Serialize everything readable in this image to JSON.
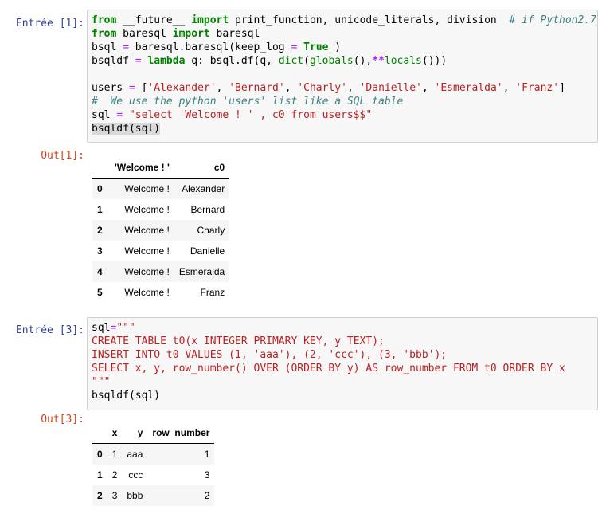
{
  "cells": [
    {
      "in_prompt": "Entrée [1]:",
      "out_prompt": "Out[1]:",
      "table": {
        "columns": [
          "'Welcome ! '",
          "c0"
        ],
        "rows": [
          {
            "index": "0",
            "values": [
              "Welcome !",
              "Alexander"
            ]
          },
          {
            "index": "1",
            "values": [
              "Welcome !",
              "Bernard"
            ]
          },
          {
            "index": "2",
            "values": [
              "Welcome !",
              "Charly"
            ]
          },
          {
            "index": "3",
            "values": [
              "Welcome !",
              "Danielle"
            ]
          },
          {
            "index": "4",
            "values": [
              "Welcome !",
              "Esmeralda"
            ]
          },
          {
            "index": "5",
            "values": [
              "Welcome !",
              "Franz"
            ]
          }
        ]
      }
    },
    {
      "in_prompt": "Entrée [3]:",
      "out_prompt": "Out[3]:",
      "table": {
        "columns": [
          "x",
          "y",
          "row_number"
        ],
        "rows": [
          {
            "index": "0",
            "values": [
              "1",
              "aaa",
              "1"
            ]
          },
          {
            "index": "1",
            "values": [
              "2",
              "ccc",
              "3"
            ]
          },
          {
            "index": "2",
            "values": [
              "3",
              "bbb",
              "2"
            ]
          }
        ]
      }
    }
  ],
  "code": {
    "c1": {
      "l1_from": "from",
      "l1_mod": " __future__ ",
      "l1_import": "import",
      "l1_names": " print_function, unicode_literals, division  ",
      "l1_cmt": "# if Python2.7",
      "l2_from": "from",
      "l2_mod": " baresql ",
      "l2_import": "import",
      "l2_name": " baresql",
      "l3_a": "bsql ",
      "l3_eq": "=",
      "l3_b": " baresql.baresql(keep_log ",
      "l3_eq2": "=",
      "l3_sp": " ",
      "l3_true": "True",
      "l3_c": " )",
      "l4_a": "bsqldf ",
      "l4_eq": "=",
      "l4_sp": " ",
      "l4_lambda": "lambda",
      "l4_b": " q: bsql.df(q, ",
      "l4_dict": "dict",
      "l4_c": "(",
      "l4_globals": "globals",
      "l4_d": "(),",
      "l4_star": "**",
      "l4_locals": "locals",
      "l4_e": "()))",
      "l6_a": "users ",
      "l6_eq": "=",
      "l6_b": " [",
      "s1": "'Alexander'",
      "s2": "'Bernard'",
      "s3": "'Charly'",
      "s4": "'Danielle'",
      "s5": "'Esmeralda'",
      "s6": "'Franz'",
      "comma": ", ",
      "l6_end": "]",
      "l7_cmt": "#  We use the python 'users' list like a SQL table",
      "l8_a": "sql ",
      "l8_eq": "=",
      "l8_sp": " ",
      "l8_str": "\"select 'Welcome ! ' , c0 from users$$\"",
      "l9": "bsqldf(sql)"
    },
    "c2": {
      "l1_a": "sql",
      "l1_eq": "=",
      "l1_str": "\"\"\"",
      "l2": "CREATE TABLE t0(x INTEGER PRIMARY KEY, y TEXT);",
      "l3": "INSERT INTO t0 VALUES (1, 'aaa'), (2, 'ccc'), (3, 'bbb');",
      "l4": "SELECT x, y, row_number() OVER (ORDER BY y) AS row_number FROM t0 ORDER BY x",
      "l5": "\"\"\"",
      "l6": "bsqldf(sql)"
    }
  }
}
